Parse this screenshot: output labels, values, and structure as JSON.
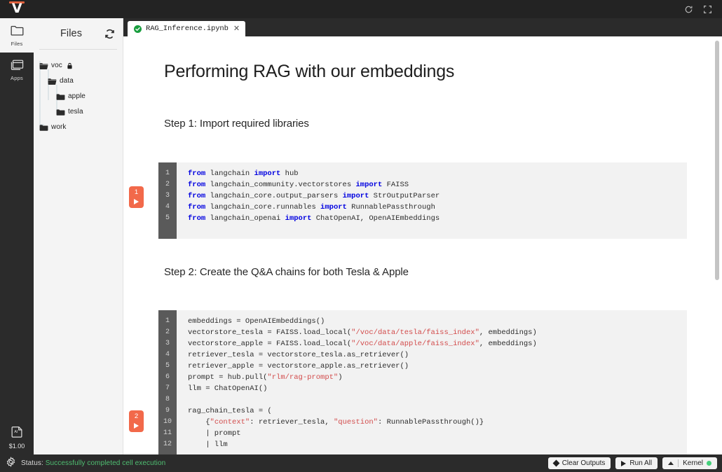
{
  "titlebar": {
    "logo": "V",
    "logo_icon": "vessl-logo",
    "refresh_icon": "refresh-icon",
    "fullscreen_icon": "expand-fullscreen-icon"
  },
  "rail": {
    "items": [
      {
        "label": "Files",
        "icon": "folder-icon",
        "active": true
      },
      {
        "label": "Apps",
        "icon": "apps-window-icon",
        "active": false
      }
    ],
    "bottom": {
      "icon": "ai-document-icon",
      "cost": "$1.00"
    }
  },
  "files_panel": {
    "title": "Files",
    "refresh_icon": "refresh-icon",
    "tree": [
      {
        "label": "voc",
        "depth": 0,
        "icon": "folder-open-icon",
        "locked": true,
        "lock_icon": "lock-icon"
      },
      {
        "label": "data",
        "depth": 1,
        "icon": "folder-open-icon",
        "locked": false
      },
      {
        "label": "apple",
        "depth": 2,
        "icon": "folder-closed-icon",
        "locked": false
      },
      {
        "label": "tesla",
        "depth": 2,
        "icon": "folder-closed-icon",
        "locked": false
      },
      {
        "label": "work",
        "depth": 0,
        "icon": "folder-closed-icon",
        "locked": false
      }
    ]
  },
  "tabs": [
    {
      "label": "RAG_Inference.ipynb",
      "status_icon": "check-circle-icon",
      "close_icon": "close-icon",
      "active": true
    }
  ],
  "notebook": {
    "title": "Performing RAG with our embeddings",
    "sections": [
      {
        "heading": "Step 1: Import required libraries"
      },
      {
        "heading": "Step 2: Create the Q&A chains for both Tesla & Apple"
      }
    ],
    "cells": [
      {
        "exec_count": "1",
        "run_icon": "play-icon",
        "first_line": 1,
        "lines": [
          "from langchain import hub",
          "from langchain_community.vectorstores import FAISS",
          "from langchain_core.output_parsers import StrOutputParser",
          "from langchain_core.runnables import RunnablePassthrough",
          "from langchain_openai import ChatOpenAI, OpenAIEmbeddings"
        ]
      },
      {
        "exec_count": "2",
        "run_icon": "play-icon",
        "first_line": 1,
        "lines": [
          "embeddings = OpenAIEmbeddings()",
          "vectorstore_tesla = FAISS.load_local(\"/voc/data/tesla/faiss_index\", embeddings)",
          "vectorstore_apple = FAISS.load_local(\"/voc/data/apple/faiss_index\", embeddings)",
          "retriever_tesla = vectorstore_tesla.as_retriever()",
          "retriever_apple = vectorstore_apple.as_retriever()",
          "prompt = hub.pull(\"rlm/rag-prompt\")",
          "llm = ChatOpenAI()",
          "",
          "rag_chain_tesla = (",
          "    {\"context\": retriever_tesla, \"question\": RunnablePassthrough()}",
          "    | prompt",
          "    | llm"
        ]
      }
    ]
  },
  "statusbar": {
    "settings_icon": "gear-icon",
    "status_label": "Status:",
    "status_value": "Successfully completed cell execution",
    "status_color": "#4fbf72",
    "buttons": [
      {
        "label": "Clear Outputs",
        "icon": "eraser-icon"
      },
      {
        "label": "Run All",
        "icon": "play-icon"
      },
      {
        "label": "Kernel",
        "icon": "caret-up-icon",
        "dot_color": "#44d07b"
      }
    ]
  }
}
